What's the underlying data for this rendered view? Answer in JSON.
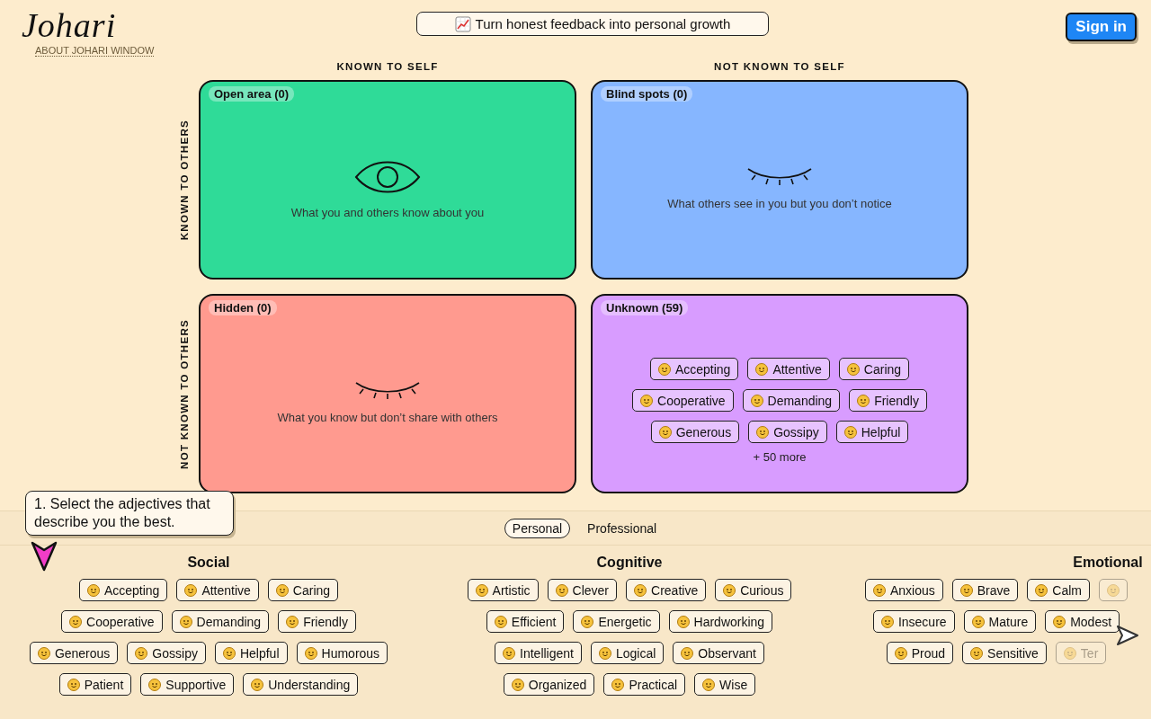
{
  "header": {
    "logo": "Johari",
    "about_link": "ABOUT JOHARI WINDOW",
    "tagline": "Turn honest feedback into personal growth",
    "sign_in": "Sign in"
  },
  "axes": {
    "columns": [
      "KNOWN TO SELF",
      "NOT KNOWN TO SELF"
    ],
    "rows": [
      "KNOWN TO OTHERS",
      "NOT KNOWN TO OTHERS"
    ]
  },
  "quadrants": [
    {
      "kind": "open",
      "title": "Open area (0)",
      "caption": "What you and others know about you",
      "color": "#2fdb98"
    },
    {
      "kind": "blind",
      "title": "Blind spots (0)",
      "caption": "What others see in you but you don’t notice",
      "color": "#86b6ff"
    },
    {
      "kind": "hidden",
      "title": "Hidden (0)",
      "caption": "What you know but don’t share with others",
      "color": "#ff9a8f"
    },
    {
      "kind": "unknown",
      "title": "Unknown (59)",
      "color": "#d89cff",
      "chip_rows": [
        [
          "Accepting",
          "Attentive",
          "Caring"
        ],
        [
          "Cooperative",
          "Demanding",
          "Friendly"
        ],
        [
          "Generous",
          "Gossipy",
          "Helpful"
        ]
      ],
      "more": "+ 50 more"
    }
  ],
  "tabs": [
    {
      "label": "Personal",
      "selected": true
    },
    {
      "label": "Professional",
      "selected": false
    }
  ],
  "tooltip": "1. Select the adjectives that describe you the best.",
  "categories": [
    {
      "title": "Social",
      "rows": [
        [
          {
            "label": "Accepting"
          },
          {
            "label": "Attentive"
          },
          {
            "label": "Caring"
          }
        ],
        [
          {
            "label": "Cooperative"
          },
          {
            "label": "Demanding"
          },
          {
            "label": "Friendly"
          }
        ],
        [
          {
            "label": "Generous"
          },
          {
            "label": "Gossipy"
          },
          {
            "label": "Helpful"
          },
          {
            "label": "Humorous"
          }
        ],
        [
          {
            "label": "Patient"
          },
          {
            "label": "Supportive"
          },
          {
            "label": "Understanding"
          }
        ]
      ]
    },
    {
      "title": "Cognitive",
      "rows": [
        [
          {
            "label": "Artistic"
          },
          {
            "label": "Clever"
          },
          {
            "label": "Creative"
          },
          {
            "label": "Curious"
          }
        ],
        [
          {
            "label": "Efficient"
          },
          {
            "label": "Energetic"
          },
          {
            "label": "Hardworking"
          }
        ],
        [
          {
            "label": "Intelligent"
          },
          {
            "label": "Logical"
          },
          {
            "label": "Observant"
          }
        ],
        [
          {
            "label": "Organized"
          },
          {
            "label": "Practical"
          },
          {
            "label": "Wise"
          }
        ]
      ]
    },
    {
      "title": "Emotional",
      "rows": [
        [
          {
            "label": "Anxious",
            "faded": false
          },
          {
            "label": "Brave",
            "faded": false
          },
          {
            "label": "Calm",
            "faded": false
          },
          {
            "faded": true
          }
        ],
        [
          {
            "label": "Insecure",
            "faded": false
          },
          {
            "label": "Mature",
            "faded": false
          },
          {
            "label": "Modest",
            "faded": false
          }
        ],
        [
          {
            "label": "Proud",
            "faded": false
          },
          {
            "label": "Sensitive",
            "faded": false
          },
          {
            "label": "Ter",
            "faded": true
          }
        ]
      ]
    }
  ]
}
